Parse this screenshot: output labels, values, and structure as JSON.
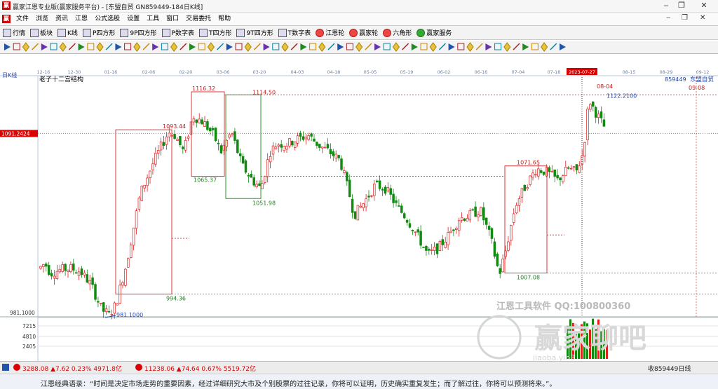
{
  "window": {
    "title": "赢家江恩专业版(赢家服务平台) - [东盟自贸  GN859449-184日K线]",
    "logo": "赢"
  },
  "menu": {
    "items": [
      "文件",
      "浏览",
      "资讯",
      "江恩",
      "公式选股",
      "设置",
      "工具",
      "窗口",
      "交易委托",
      "帮助"
    ]
  },
  "toolbar": {
    "items": [
      {
        "label": "行情",
        "icon": "grid-icon"
      },
      {
        "label": "板块",
        "icon": "blocks-icon"
      },
      {
        "label": "K线",
        "icon": "kline-icon"
      },
      {
        "label": "P四方形",
        "icon": "square-icon"
      },
      {
        "label": "9P四方形",
        "icon": "square-icon"
      },
      {
        "label": "P数字表",
        "icon": "table-icon"
      },
      {
        "label": "T四方形",
        "icon": "square-icon"
      },
      {
        "label": "9T四方形",
        "icon": "square-icon"
      },
      {
        "label": "T数字表",
        "icon": "table-icon"
      },
      {
        "label": "江恩轮",
        "icon": "wheel-icon"
      },
      {
        "label": "赢家轮",
        "icon": "wheel-icon"
      },
      {
        "label": "六角形",
        "icon": "hexagon-icon"
      },
      {
        "label": "赢家服务",
        "icon": "dollar-icon"
      }
    ]
  },
  "chart": {
    "period_label": "日K线",
    "study_name": "老子十二宫结构",
    "code": "859449",
    "name": "东盟自贸",
    "selected_date": "2023-07-27",
    "date_labels": [
      "12-16",
      "12-30",
      "01-16",
      "02-06",
      "02-20",
      "03-06",
      "03-20",
      "04-03",
      "04-18",
      "05-05",
      "05-19",
      "06-02",
      "06-16",
      "07-04",
      "07-18",
      "2023-07-27",
      "08-15",
      "08-29",
      "09-12"
    ],
    "price_current_label": "1091.2424",
    "price_min_label": "981.1000",
    "vol_labels": [
      "7215",
      "4810",
      "2405"
    ],
    "annotations": [
      "1116.32",
      "1114.50",
      "1093.44",
      "1065.37",
      "1051.98",
      "994.36",
      "981.1000",
      "1071.65",
      "1007.08",
      "1122.2100",
      "08-04",
      "09-08"
    ],
    "watermark_text": "江恩工具软件  QQ:100800360",
    "watermark_brand": "赢家聊吧",
    "watermark_url": "jiaoba.yin3...",
    "colors": {
      "up": "#e02020",
      "down": "#108a10",
      "accent": "#d00000",
      "box_red": "#d83a3a",
      "box_green": "#2a9a2a"
    }
  },
  "status": {
    "index1": "3288.08 ▲7.62 0.23% 4971.8亿",
    "index2": "11238.06 ▲74.64 0.67% 5519.72亿",
    "right": "收859449日线"
  },
  "quote": "江恩经典语录：“时间是决定市场走势的重要因素，经过详细研究大市及个别股票的过往记录，你将可以证明，历史确实重复发生；而了解过往，你将可以预测将来。”。"
}
